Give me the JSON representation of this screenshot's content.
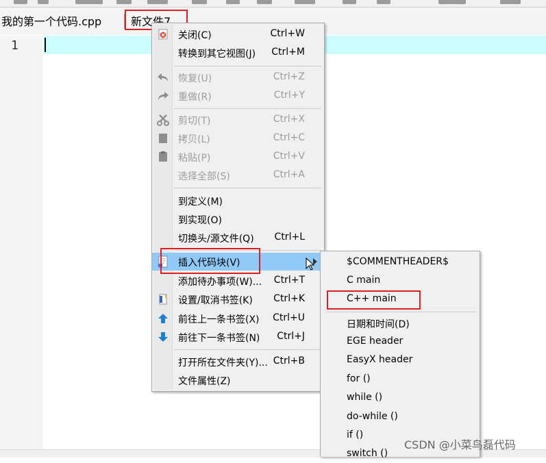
{
  "tabs": [
    {
      "label": "我的第一个代码.cpp"
    },
    {
      "label": "新文件7"
    }
  ],
  "editor": {
    "line_number": "1"
  },
  "context_menu": {
    "items": [
      {
        "label": "关闭(C)",
        "shortcut": "Ctrl+W",
        "icon": "close-icon",
        "enabled": true
      },
      {
        "label": "转换到其它视图(J)",
        "shortcut": "Ctrl+M",
        "icon": "",
        "enabled": true
      },
      {
        "label": "恢复(U)",
        "shortcut": "Ctrl+Z",
        "icon": "undo-icon",
        "enabled": false
      },
      {
        "label": "重做(R)",
        "shortcut": "Ctrl+Y",
        "icon": "redo-icon",
        "enabled": false
      },
      {
        "label": "剪切(T)",
        "shortcut": "Ctrl+X",
        "icon": "cut-icon",
        "enabled": false
      },
      {
        "label": "拷贝(L)",
        "shortcut": "Ctrl+C",
        "icon": "copy-icon",
        "enabled": false
      },
      {
        "label": "粘贴(P)",
        "shortcut": "Ctrl+V",
        "icon": "paste-icon",
        "enabled": false
      },
      {
        "label": "选择全部(S)",
        "shortcut": "Ctrl+A",
        "icon": "",
        "enabled": false
      },
      {
        "label": "到定义(M)",
        "shortcut": "",
        "icon": "",
        "enabled": true
      },
      {
        "label": "到实现(O)",
        "shortcut": "",
        "icon": "",
        "enabled": true
      },
      {
        "label": "切换头/源文件(Q)",
        "shortcut": "Ctrl+L",
        "icon": "",
        "enabled": true
      },
      {
        "label": "插入代码块(V)",
        "shortcut": "",
        "icon": "code-snippet-icon",
        "enabled": true,
        "highlighted": true
      },
      {
        "label": "添加待办事项(W)...",
        "shortcut": "Ctrl+T",
        "icon": "",
        "enabled": true
      },
      {
        "label": "设置/取消书签(K)",
        "shortcut": "Ctrl+K",
        "icon": "bookmark-icon",
        "enabled": true
      },
      {
        "label": "前往上一条书签(X)",
        "shortcut": "Ctrl+U",
        "icon": "arrow-up-icon",
        "enabled": true
      },
      {
        "label": "前往下一条书签(N)",
        "shortcut": "Ctrl+J",
        "icon": "arrow-down-icon",
        "enabled": true
      },
      {
        "label": "打开所在文件夹(Y)...",
        "shortcut": "Ctrl+B",
        "icon": "",
        "enabled": true
      },
      {
        "label": "文件属性(Z)",
        "shortcut": "",
        "icon": "",
        "enabled": true
      }
    ]
  },
  "submenu": {
    "items": [
      {
        "label": "$COMMENTHEADER$"
      },
      {
        "label": "C main"
      },
      {
        "label": "C++ main"
      },
      {
        "label": "日期和时间(D)"
      },
      {
        "label": "EGE header"
      },
      {
        "label": "EasyX header"
      },
      {
        "label": "for ()"
      },
      {
        "label": "while ()"
      },
      {
        "label": "do-while ()"
      },
      {
        "label": "if ()"
      },
      {
        "label": "switch ()"
      }
    ]
  },
  "watermark": "CSDN @小菜鸟磊代码",
  "colors": {
    "annotation_red": "#e31b23",
    "current_line": "#ccfcff",
    "menu_highlight": "#91c9f7",
    "arrow_blue": "#1e7fd8"
  }
}
